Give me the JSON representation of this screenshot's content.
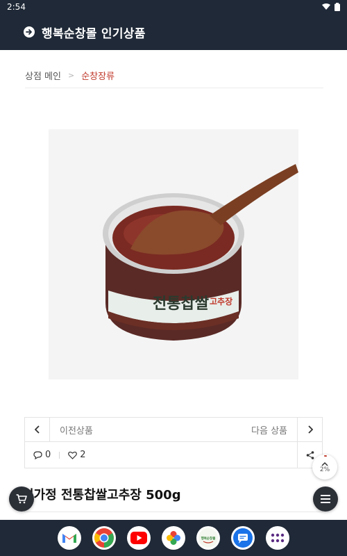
{
  "status_bar": {
    "time": "2:54"
  },
  "header": {
    "title": "행복순창몰 인기상품"
  },
  "breadcrumb": {
    "home": "상점 메인",
    "separator": ">",
    "current": "순창장류"
  },
  "product_nav": {
    "prev_label": "이전상품",
    "next_label": "다음 상품"
  },
  "meta": {
    "comment_count": "0",
    "like_count": "2"
  },
  "scroll_progress": {
    "label": "2%",
    "value": 0.02
  },
  "product": {
    "title": "성가정 전통찹쌀고추장 500g",
    "label_brand": "전통찹쌀",
    "label_accent": "고추장"
  },
  "dock": {
    "apps": [
      "gmail-icon",
      "chrome-icon",
      "youtube-icon",
      "photos-icon",
      "shop-app-icon",
      "messages-icon",
      "app-drawer-icon"
    ],
    "shop_app_text": "행복순창몰"
  },
  "colors": {
    "header_bg": "#1f2937",
    "accent": "#c0392b",
    "fab_bg": "#2b2f36"
  }
}
